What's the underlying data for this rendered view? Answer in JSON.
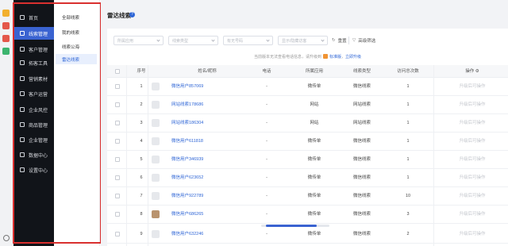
{
  "colors": {
    "accent": "#3a63d1",
    "nav_bg": "#111419",
    "highlight_box": "#d9302f",
    "link": "#2f66d6"
  },
  "nav": {
    "items": [
      {
        "label": "首页",
        "icon": "home-icon"
      },
      {
        "label": "线索管理",
        "icon": "clue-icon",
        "active": true
      },
      {
        "label": "客户管理",
        "icon": "customer-icon"
      },
      {
        "label": "拓客工具",
        "icon": "tool-icon"
      },
      {
        "label": "营销素材",
        "icon": "megaphone-icon"
      },
      {
        "label": "客户运营",
        "icon": "operate-icon"
      },
      {
        "label": "企业风控",
        "icon": "risk-icon"
      },
      {
        "label": "商品管理",
        "icon": "goods-icon"
      },
      {
        "label": "企业管理",
        "icon": "company-icon"
      },
      {
        "label": "数据中心",
        "icon": "data-icon"
      },
      {
        "label": "设置中心",
        "icon": "settings-icon"
      }
    ]
  },
  "submenu": {
    "items": [
      "全部线索",
      "我的线索",
      "线索公海",
      "雷达线索"
    ],
    "active_index": 3
  },
  "page": {
    "title": "雷达线索",
    "help_icon": "?"
  },
  "filters": [
    {
      "placeholder": "所属应用"
    },
    {
      "placeholder": "线索类型"
    },
    {
      "placeholder": "有无号码"
    },
    {
      "placeholder": "显示/隐藏访客"
    }
  ],
  "toolbar": {
    "reset_label": "重置",
    "advanced_label": "高级筛选"
  },
  "notice": {
    "text": "当前版本无法查看电话信息，请升级到",
    "badge": "标准版",
    "separator": "，",
    "link": "立即升级"
  },
  "table": {
    "headers": [
      "序号",
      "姓名/昵称",
      "电话",
      "所属应用",
      "线索类型",
      "访问总次数",
      "操作"
    ],
    "rows": [
      {
        "index": "1",
        "name": "微信用户857069",
        "phone": "-",
        "app": "微传单",
        "type": "微信线索",
        "visits": "1",
        "op": "升级后可操作"
      },
      {
        "index": "2",
        "name": "网站线索178686",
        "phone": "-",
        "app": "网站",
        "type": "网站线索",
        "visits": "1",
        "op": "升级后可操作"
      },
      {
        "index": "3",
        "name": "网站线索186304",
        "phone": "-",
        "app": "网站",
        "type": "网站线索",
        "visits": "1",
        "op": "升级后可操作"
      },
      {
        "index": "4",
        "name": "微信用户611818",
        "phone": "-",
        "app": "微传单",
        "type": "微信线索",
        "visits": "1",
        "op": "升级后可操作"
      },
      {
        "index": "5",
        "name": "微信用户346939",
        "phone": "-",
        "app": "微传单",
        "type": "微信线索",
        "visits": "1",
        "op": "升级后可操作"
      },
      {
        "index": "6",
        "name": "微信用户623652",
        "phone": "-",
        "app": "微传单",
        "type": "微信线索",
        "visits": "1",
        "op": "升级后可操作"
      },
      {
        "index": "7",
        "name": "微信用户922789",
        "phone": "-",
        "app": "微传单",
        "type": "微信线索",
        "visits": "10",
        "op": "升级后可操作"
      },
      {
        "index": "8",
        "name": "微信用户686265",
        "phone": "-",
        "app": "微传单",
        "type": "微信线索",
        "visits": "3",
        "op": "升级后可操作"
      },
      {
        "index": "9",
        "name": "微信用户632246",
        "phone": "-",
        "app": "微传单",
        "type": "微信线索",
        "visits": "2",
        "op": "升级后可操作"
      }
    ]
  }
}
